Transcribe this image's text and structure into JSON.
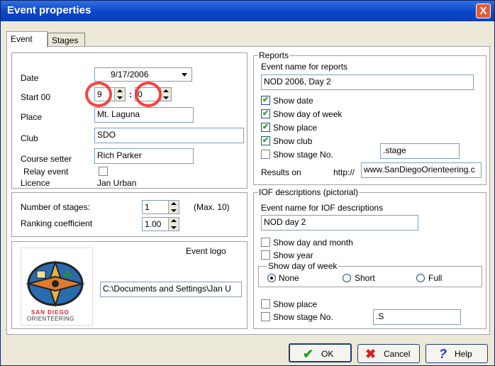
{
  "window": {
    "title": "Event properties",
    "close_glyph": "X"
  },
  "tabs": [
    {
      "label": "Event",
      "active": true
    },
    {
      "label": "Stages",
      "active": false
    }
  ],
  "event": {
    "date_label": "Date",
    "date_value": "9/17/2006",
    "start_label": "Start 00",
    "start_hour": "9",
    "start_sep": ":",
    "start_min": "0",
    "place_label": "Place",
    "place_value": "Mt. Laguna",
    "club_label": "Club",
    "club_value": "SDO",
    "setter_label": "Course setter",
    "setter_value": "Rich Parker",
    "relay_label": "Relay event",
    "relay_checked": false,
    "licence_label": "Licence",
    "licence_value": "Jan Urban"
  },
  "stages": {
    "number_label": "Number of stages:",
    "number_value": "1",
    "max_note": "(Max. 10)",
    "ranking_label": "Ranking coefficient",
    "ranking_value": "1.00"
  },
  "logo": {
    "label": "Event logo",
    "path_value": "C:\\Documents and Settings\\Jan U",
    "logo_text_line1": "SAN DIEGO",
    "logo_text_line2": "ORIENTEERING"
  },
  "reports": {
    "legend": "Reports",
    "name_label": "Event name for reports",
    "name_value": "NOD 2006, Day 2",
    "options": [
      {
        "label": "Show date",
        "checked": true
      },
      {
        "label": "Show day of week",
        "checked": true
      },
      {
        "label": "Show place",
        "checked": true
      },
      {
        "label": "Show club",
        "checked": true
      },
      {
        "label": "Show stage No.",
        "checked": false
      }
    ],
    "stage_value": ".stage",
    "results_label": "Results on",
    "results_prefix": "http://",
    "results_value": "www.SanDiegoOrienteering.c"
  },
  "iof": {
    "legend": "IOF descriptions (pictorial)",
    "name_label": "Event name for IOF descriptions",
    "name_value": "NOD day 2",
    "day_month_label": "Show day and month",
    "day_month_checked": false,
    "year_label": "Show year",
    "year_checked": false,
    "dow_legend": "Show day of week",
    "dow_options": [
      {
        "label": "None",
        "selected": true
      },
      {
        "label": "Short",
        "selected": false
      },
      {
        "label": "Full",
        "selected": false
      }
    ],
    "place_label": "Show place",
    "place_checked": false,
    "stage_label": "Show stage No.",
    "stage_checked": false,
    "stage_value": ".S"
  },
  "buttons": {
    "ok_label": "OK",
    "cancel_label": "Cancel",
    "help_label": "Help"
  },
  "colors": {
    "titlebar": "#0b46c8",
    "ok_icon": "#21a121",
    "cancel_icon": "#d62020",
    "help_icon": "#1a3fc0",
    "highlight": "#ff1e1e"
  }
}
